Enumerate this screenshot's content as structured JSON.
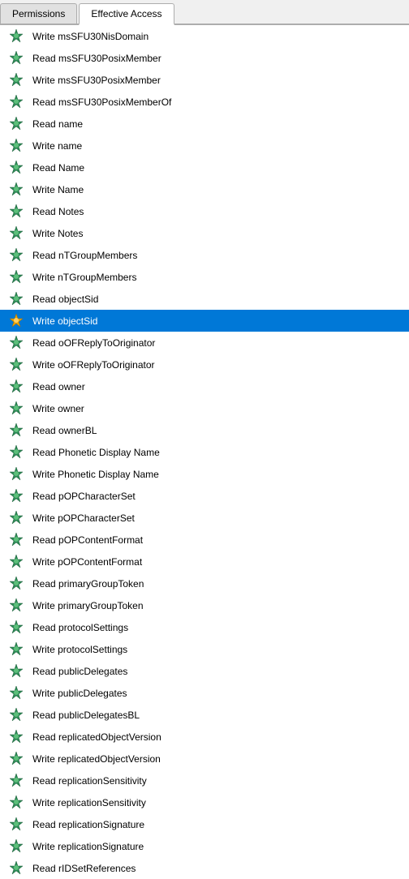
{
  "tabs": [
    {
      "id": "permissions",
      "label": "Permissions",
      "active": false
    },
    {
      "id": "effective-access",
      "label": "Effective Access",
      "active": true
    }
  ],
  "items": [
    {
      "id": 1,
      "label": "Write msSFU30NisDomain",
      "selected": false
    },
    {
      "id": 2,
      "label": "Read msSFU30PosixMember",
      "selected": false
    },
    {
      "id": 3,
      "label": "Write msSFU30PosixMember",
      "selected": false
    },
    {
      "id": 4,
      "label": "Read msSFU30PosixMemberOf",
      "selected": false
    },
    {
      "id": 5,
      "label": "Read name",
      "selected": false
    },
    {
      "id": 6,
      "label": "Write name",
      "selected": false
    },
    {
      "id": 7,
      "label": "Read Name",
      "selected": false
    },
    {
      "id": 8,
      "label": "Write Name",
      "selected": false
    },
    {
      "id": 9,
      "label": "Read Notes",
      "selected": false
    },
    {
      "id": 10,
      "label": "Write Notes",
      "selected": false
    },
    {
      "id": 11,
      "label": "Read nTGroupMembers",
      "selected": false
    },
    {
      "id": 12,
      "label": "Write nTGroupMembers",
      "selected": false
    },
    {
      "id": 13,
      "label": "Read objectSid",
      "selected": false
    },
    {
      "id": 14,
      "label": "Write objectSid",
      "selected": true
    },
    {
      "id": 15,
      "label": "Read oOFReplyToOriginator",
      "selected": false
    },
    {
      "id": 16,
      "label": "Write oOFReplyToOriginator",
      "selected": false
    },
    {
      "id": 17,
      "label": "Read owner",
      "selected": false
    },
    {
      "id": 18,
      "label": "Write owner",
      "selected": false
    },
    {
      "id": 19,
      "label": "Read ownerBL",
      "selected": false
    },
    {
      "id": 20,
      "label": "Read Phonetic Display Name",
      "selected": false
    },
    {
      "id": 21,
      "label": "Write Phonetic Display Name",
      "selected": false
    },
    {
      "id": 22,
      "label": "Read pOPCharacterSet",
      "selected": false
    },
    {
      "id": 23,
      "label": "Write pOPCharacterSet",
      "selected": false
    },
    {
      "id": 24,
      "label": "Read pOPContentFormat",
      "selected": false
    },
    {
      "id": 25,
      "label": "Write pOPContentFormat",
      "selected": false
    },
    {
      "id": 26,
      "label": "Read primaryGroupToken",
      "selected": false
    },
    {
      "id": 27,
      "label": "Write primaryGroupToken",
      "selected": false
    },
    {
      "id": 28,
      "label": "Read protocolSettings",
      "selected": false
    },
    {
      "id": 29,
      "label": "Write protocolSettings",
      "selected": false
    },
    {
      "id": 30,
      "label": "Read publicDelegates",
      "selected": false
    },
    {
      "id": 31,
      "label": "Write publicDelegates",
      "selected": false
    },
    {
      "id": 32,
      "label": "Read publicDelegatesBL",
      "selected": false
    },
    {
      "id": 33,
      "label": "Read replicatedObjectVersion",
      "selected": false
    },
    {
      "id": 34,
      "label": "Write replicatedObjectVersion",
      "selected": false
    },
    {
      "id": 35,
      "label": "Read replicationSensitivity",
      "selected": false
    },
    {
      "id": 36,
      "label": "Write replicationSensitivity",
      "selected": false
    },
    {
      "id": 37,
      "label": "Read replicationSignature",
      "selected": false
    },
    {
      "id": 38,
      "label": "Write replicationSignature",
      "selected": false
    },
    {
      "id": 39,
      "label": "Read rIDSetReferences",
      "selected": false
    }
  ],
  "colors": {
    "selected_bg": "#0078d7",
    "tab_active_bg": "#ffffff",
    "tab_inactive_bg": "#e1e1e1"
  }
}
